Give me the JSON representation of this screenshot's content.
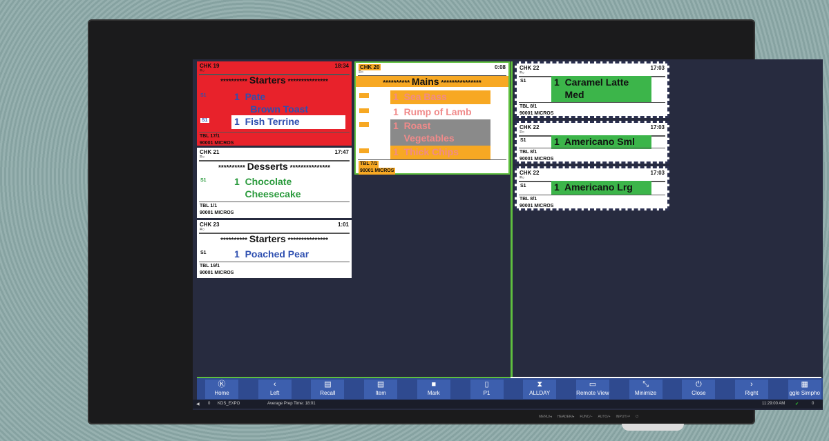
{
  "cards": [
    {
      "id": "chk19",
      "check": "CHK 19",
      "time": "18:34",
      "course": "Starters",
      "bg": "#e8222b",
      "items": [
        {
          "seat": "S1",
          "text": "1  Pate\n      Brown Toast",
          "color": "#2e4fb0",
          "bg": ""
        },
        {
          "seat": "S1",
          "text": "1  Fish Terrine",
          "color": "#2e4fb0",
          "bg": "#ffffff"
        }
      ],
      "table": "TBL 17/1",
      "server": "90001 MICROS"
    },
    {
      "id": "chk21",
      "check": "CHK 21",
      "time": "17:47",
      "course": "Desserts",
      "bg": "#ffffff",
      "items": [
        {
          "seat": "S1",
          "text": "1  Chocolate\n    Cheesecake",
          "color": "#2a9a3c",
          "bg": ""
        }
      ],
      "table": "TBL 1/1",
      "server": "90001 MICROS"
    },
    {
      "id": "chk23",
      "check": "CHK 23",
      "time": "1:01",
      "course": "Starters",
      "bg": "#ffffff",
      "items": [
        {
          "seat": "S1",
          "text": "1  Poached Pear",
          "color": "#2e4fb0",
          "bg": ""
        }
      ],
      "table": "TBL 19/1",
      "server": "90001 MICROS"
    },
    {
      "id": "chk20",
      "check": "CHK 20",
      "time": "0:08",
      "course": "Mains",
      "bg": "#ffffff",
      "items": [
        {
          "seat": "S1",
          "text": "1  Sea Bass",
          "color": "#f08a8a",
          "bg": "#f7a823"
        },
        {
          "seat": "S1",
          "text": "1  Rump of Lamb",
          "color": "#f08a8a",
          "bg": ""
        },
        {
          "seat": "S1",
          "text": "1  Roast\n    Vegetables",
          "color": "#f08a8a",
          "bg": "#8a8a8a"
        },
        {
          "seat": "S1",
          "text": "1  Thick Chips",
          "color": "#f08a8a",
          "bg": "#f7a823"
        }
      ],
      "table": "TBL 7/1",
      "server": "90001 MICROS"
    },
    {
      "id": "chk22a",
      "check": "CHK 22",
      "time": "17:03",
      "course": "",
      "bg": "#ffffff",
      "items": [
        {
          "seat": "S1",
          "text": "1  Caramel Latte\n    Med",
          "color": "#111",
          "bg": "#3cb54a"
        }
      ],
      "table": "TBL 8/1",
      "server": "90001 MICROS"
    },
    {
      "id": "chk22b",
      "check": "CHK 22",
      "time": "17:03",
      "course": "",
      "bg": "#ffffff",
      "items": [
        {
          "seat": "S1",
          "text": "1  Americano Sml",
          "color": "#111",
          "bg": "#3cb54a"
        }
      ],
      "table": "TBL 8/1",
      "server": "90001 MICROS"
    },
    {
      "id": "chk22c",
      "check": "CHK 22",
      "time": "17:03",
      "course": "",
      "bg": "#ffffff",
      "items": [
        {
          "seat": "S1",
          "text": "1  Americano Lrg",
          "color": "#111",
          "bg": "#3cb54a"
        }
      ],
      "table": "TBL 8/1",
      "server": "90001 MICROS"
    }
  ],
  "toolbar": [
    {
      "label": "Home",
      "icon": "Ⓚ"
    },
    {
      "label": "Left",
      "icon": "‹"
    },
    {
      "label": "Recall",
      "icon": "▤"
    },
    {
      "label": "Item",
      "icon": "▤"
    },
    {
      "label": "Mark",
      "icon": "■"
    },
    {
      "label": "P1",
      "icon": "▯"
    },
    {
      "label": "ALLDAY",
      "icon": "⧗"
    },
    {
      "label": "Remote View",
      "icon": "▭"
    },
    {
      "label": "Minimize",
      "icon": "⤡"
    },
    {
      "label": "Close",
      "icon": "⏻"
    },
    {
      "label": "Right",
      "icon": "›"
    },
    {
      "label": "ggle Simpho",
      "icon": "▦"
    }
  ],
  "status": {
    "count_left": "0",
    "station": "KDS_EXPO",
    "avg_prep": "Average Prep Time: 18:01",
    "clock": "11:29:00 AM",
    "count_right": "0"
  },
  "monitor_buttons": [
    "MENU/◂",
    "HEADER/▸",
    "FUNC/–",
    "AUTO/+",
    "INPUT/⏎",
    "⏻"
  ]
}
